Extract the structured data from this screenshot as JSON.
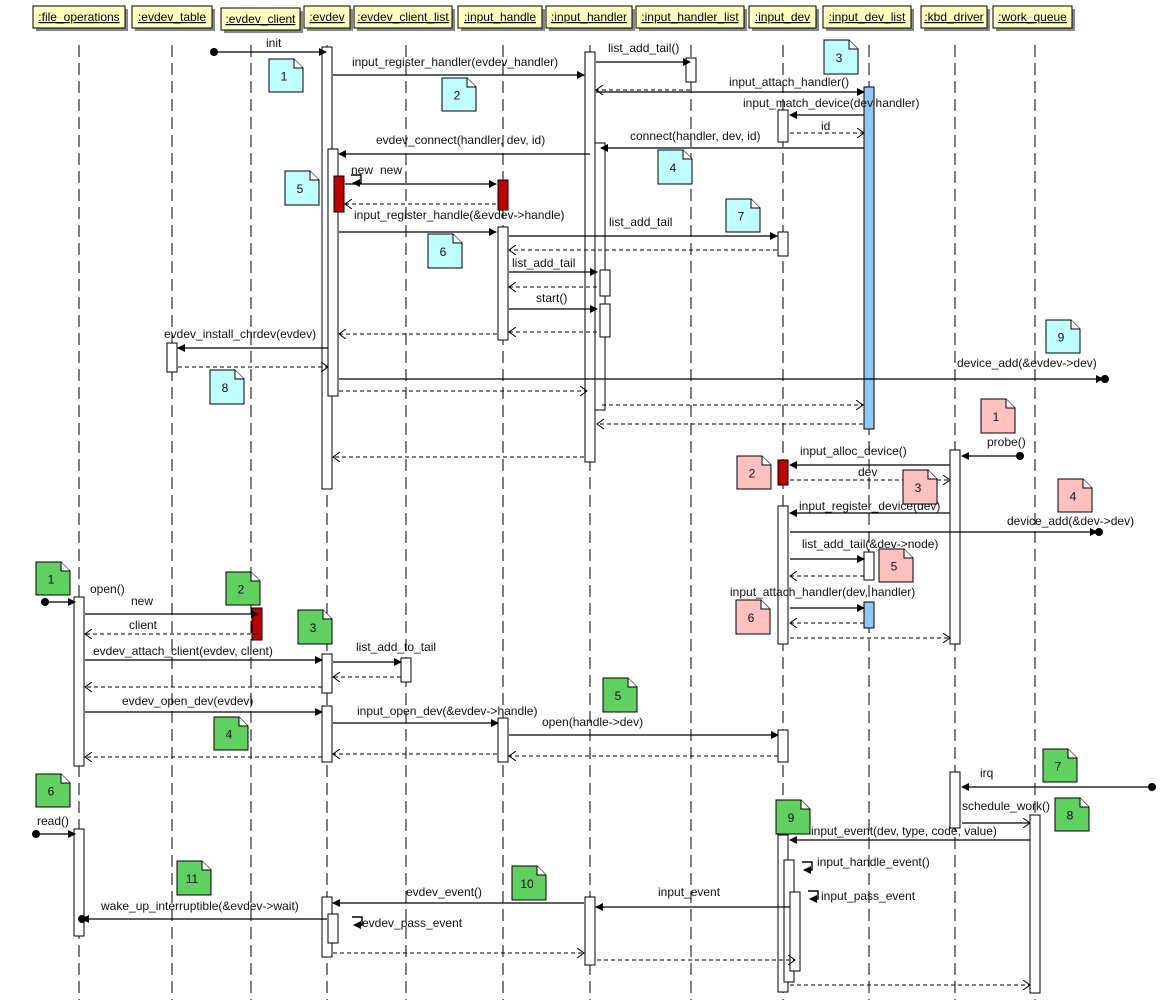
{
  "diagram": {
    "type": "uml-sequence",
    "colors": {
      "header_fill": "#ffffc0",
      "header_shadow": "#888888",
      "note_cyan": "#c0ffff",
      "note_pink": "#ffc0c0",
      "note_green": "#60d060",
      "activation_red": "#c00000",
      "activation_blue": "#90c8f8",
      "line": "#000000"
    },
    "lifelines": [
      {
        "id": "file_operations",
        "label": ":file_operations"
      },
      {
        "id": "evdev_table",
        "label": ":evdev_table"
      },
      {
        "id": "evdev_client",
        "label": ":evdev_client"
      },
      {
        "id": "evdev",
        "label": ":evdev"
      },
      {
        "id": "evdev_client_list",
        "label": ":evdev_client_list"
      },
      {
        "id": "input_handle",
        "label": ":input_handle"
      },
      {
        "id": "input_handler",
        "label": ":input_handler"
      },
      {
        "id": "input_handler_list",
        "label": ":input_handler_list"
      },
      {
        "id": "input_dev",
        "label": ":input_dev"
      },
      {
        "id": "input_dev_list",
        "label": ":input_dev_list"
      },
      {
        "id": "kbd_driver",
        "label": ":kbd_driver"
      },
      {
        "id": "work_queue",
        "label": ":work_queue"
      }
    ],
    "messages": [
      {
        "label": "init",
        "from": "start",
        "to": "evdev",
        "kind": "call"
      },
      {
        "label": "input_register_handler(evdev_handler)",
        "from": "evdev",
        "to": "input_handler",
        "kind": "call"
      },
      {
        "label": "list_add_tail()",
        "from": "input_handler",
        "to": "input_handler_list",
        "kind": "call"
      },
      {
        "label": "",
        "from": "input_handler_list",
        "to": "input_handler",
        "kind": "return"
      },
      {
        "label": "input_attach_handler()",
        "from": "input_handler",
        "to": "input_dev_list",
        "kind": "call"
      },
      {
        "label": "input_match_device(dev,handler)",
        "from": "input_dev_list",
        "to": "input_dev",
        "kind": "call"
      },
      {
        "label": "id",
        "from": "input_dev",
        "to": "input_dev_list",
        "kind": "return"
      },
      {
        "label": "connect(handler, dev, id)",
        "from": "input_dev_list",
        "to": "input_handler",
        "kind": "call"
      },
      {
        "label": "evdev_connect(handler, dev, id)",
        "from": "input_handler",
        "to": "evdev",
        "kind": "call"
      },
      {
        "label": "new",
        "from": "evdev",
        "to": "evdev",
        "kind": "self"
      },
      {
        "label": "new",
        "from": "evdev",
        "to": "input_handle",
        "kind": "call"
      },
      {
        "label": "",
        "from": "input_handle",
        "to": "evdev",
        "kind": "return"
      },
      {
        "label": "input_register_handle(&evdev->handle)",
        "from": "evdev",
        "to": "input_handle",
        "kind": "call"
      },
      {
        "label": "list_add_tail",
        "from": "input_handle",
        "to": "input_dev",
        "kind": "call"
      },
      {
        "label": "",
        "from": "input_dev",
        "to": "input_handle",
        "kind": "return"
      },
      {
        "label": "list_add_tail",
        "from": "input_handle",
        "to": "input_handler",
        "kind": "call"
      },
      {
        "label": "",
        "from": "input_handler",
        "to": "input_handle",
        "kind": "return"
      },
      {
        "label": "start()",
        "from": "input_handle",
        "to": "input_handler",
        "kind": "call"
      },
      {
        "label": "",
        "from": "input_handler",
        "to": "input_handle",
        "kind": "return"
      },
      {
        "label": "",
        "from": "input_handle",
        "to": "evdev",
        "kind": "return"
      },
      {
        "label": "evdev_install_chrdev(evdev)",
        "from": "evdev",
        "to": "evdev_table",
        "kind": "call"
      },
      {
        "label": "",
        "from": "evdev_table",
        "to": "evdev",
        "kind": "return"
      },
      {
        "label": "device_add(&evdev->dev)",
        "from": "evdev",
        "to": "end",
        "kind": "call"
      },
      {
        "label": "",
        "from": "evdev",
        "to": "input_handler",
        "kind": "return"
      },
      {
        "label": "",
        "from": "input_handler",
        "to": "input_dev_list",
        "kind": "return"
      },
      {
        "label": "",
        "from": "input_dev_list",
        "to": "input_handler",
        "kind": "return"
      },
      {
        "label": "",
        "from": "input_handler",
        "to": "evdev",
        "kind": "return"
      },
      {
        "label": "probe()",
        "from": "start",
        "to": "kbd_driver",
        "kind": "call"
      },
      {
        "label": "input_alloc_device()",
        "from": "kbd_driver",
        "to": "input_dev",
        "kind": "call"
      },
      {
        "label": "dev",
        "from": "input_dev",
        "to": "kbd_driver",
        "kind": "return"
      },
      {
        "label": "input_register_device(dev)",
        "from": "kbd_driver",
        "to": "input_dev",
        "kind": "call"
      },
      {
        "label": "device_add(&dev->dev)",
        "from": "input_dev",
        "to": "end",
        "kind": "call"
      },
      {
        "label": "list_add_tail(&dev->node)",
        "from": "input_dev",
        "to": "input_dev_list",
        "kind": "call"
      },
      {
        "label": "",
        "from": "input_dev_list",
        "to": "input_dev",
        "kind": "return"
      },
      {
        "label": "input_attach_handler(dev, handler)",
        "from": "input_dev",
        "to": "input_dev_list",
        "kind": "call"
      },
      {
        "label": "",
        "from": "input_dev_list",
        "to": "input_dev",
        "kind": "return"
      },
      {
        "label": "",
        "from": "input_dev",
        "to": "kbd_driver",
        "kind": "return"
      },
      {
        "label": "open()",
        "from": "start",
        "to": "file_operations",
        "kind": "call"
      },
      {
        "label": "new",
        "from": "file_operations",
        "to": "evdev_client",
        "kind": "call"
      },
      {
        "label": "client",
        "from": "evdev_client",
        "to": "file_operations",
        "kind": "return"
      },
      {
        "label": "evdev_attach_client(evdev, client)",
        "from": "file_operations",
        "to": "evdev",
        "kind": "call"
      },
      {
        "label": "list_add_to_tail",
        "from": "evdev",
        "to": "evdev_client_list",
        "kind": "call"
      },
      {
        "label": "",
        "from": "evdev_client_list",
        "to": "evdev",
        "kind": "return"
      },
      {
        "label": "",
        "from": "evdev",
        "to": "file_operations",
        "kind": "return"
      },
      {
        "label": "evdev_open_dev(evdev)",
        "from": "file_operations",
        "to": "evdev",
        "kind": "call"
      },
      {
        "label": "input_open_dev(&evdev->handle)",
        "from": "evdev",
        "to": "input_handle",
        "kind": "call"
      },
      {
        "label": "open(handle->dev)",
        "from": "input_handle",
        "to": "input_dev",
        "kind": "call"
      },
      {
        "label": "",
        "from": "input_dev",
        "to": "input_handle",
        "kind": "return"
      },
      {
        "label": "",
        "from": "input_handle",
        "to": "evdev",
        "kind": "return"
      },
      {
        "label": "",
        "from": "evdev",
        "to": "file_operations",
        "kind": "return"
      },
      {
        "label": "irq",
        "from": "start",
        "to": "kbd_driver",
        "kind": "call"
      },
      {
        "label": "schedule_work()",
        "from": "kbd_driver",
        "to": "work_queue",
        "kind": "async"
      },
      {
        "label": "read()",
        "from": "start",
        "to": "file_operations",
        "kind": "call"
      },
      {
        "label": "input_event(dev, type, code, value)",
        "from": "work_queue",
        "to": "input_dev",
        "kind": "call"
      },
      {
        "label": "input_handle_event()",
        "from": "input_dev",
        "to": "input_dev",
        "kind": "self"
      },
      {
        "label": "input_pass_event",
        "from": "input_dev",
        "to": "input_dev",
        "kind": "self"
      },
      {
        "label": "input_event",
        "from": "input_dev",
        "to": "input_handler",
        "kind": "call"
      },
      {
        "label": "evdev_event()",
        "from": "input_handler",
        "to": "evdev",
        "kind": "call"
      },
      {
        "label": "evdev_pass_event",
        "from": "evdev",
        "to": "evdev",
        "kind": "self"
      },
      {
        "label": "wake_up_interruptible(&evdev->wait)",
        "from": "evdev",
        "to": "file_operations",
        "kind": "call"
      },
      {
        "label": "",
        "from": "evdev",
        "to": "input_handler",
        "kind": "return"
      },
      {
        "label": "",
        "from": "input_handler",
        "to": "input_dev",
        "kind": "return"
      },
      {
        "label": "",
        "from": "input_dev",
        "to": "work_queue",
        "kind": "return"
      }
    ],
    "notes": [
      {
        "text": "1",
        "group": "handler-registration",
        "color": "cyan"
      },
      {
        "text": "2",
        "group": "handler-registration",
        "color": "cyan"
      },
      {
        "text": "3",
        "group": "handler-registration",
        "color": "cyan"
      },
      {
        "text": "4",
        "group": "handler-registration",
        "color": "cyan"
      },
      {
        "text": "5",
        "group": "handler-registration",
        "color": "cyan"
      },
      {
        "text": "6",
        "group": "handler-registration",
        "color": "cyan"
      },
      {
        "text": "7",
        "group": "handler-registration",
        "color": "cyan"
      },
      {
        "text": "8",
        "group": "handler-registration",
        "color": "cyan"
      },
      {
        "text": "9",
        "group": "handler-registration",
        "color": "cyan"
      },
      {
        "text": "1",
        "group": "device-registration",
        "color": "pink"
      },
      {
        "text": "2",
        "group": "device-registration",
        "color": "pink"
      },
      {
        "text": "3",
        "group": "device-registration",
        "color": "pink"
      },
      {
        "text": "4",
        "group": "device-registration",
        "color": "pink"
      },
      {
        "text": "5",
        "group": "device-registration",
        "color": "pink"
      },
      {
        "text": "6",
        "group": "device-registration",
        "color": "pink"
      },
      {
        "text": "1",
        "group": "open-read-event",
        "color": "green"
      },
      {
        "text": "2",
        "group": "open-read-event",
        "color": "green"
      },
      {
        "text": "3",
        "group": "open-read-event",
        "color": "green"
      },
      {
        "text": "4",
        "group": "open-read-event",
        "color": "green"
      },
      {
        "text": "5",
        "group": "open-read-event",
        "color": "green"
      },
      {
        "text": "6",
        "group": "open-read-event",
        "color": "green"
      },
      {
        "text": "7",
        "group": "open-read-event",
        "color": "green"
      },
      {
        "text": "8",
        "group": "open-read-event",
        "color": "green"
      },
      {
        "text": "9",
        "group": "open-read-event",
        "color": "green"
      },
      {
        "text": "10",
        "group": "open-read-event",
        "color": "green"
      },
      {
        "text": "11",
        "group": "open-read-event",
        "color": "green"
      }
    ]
  }
}
